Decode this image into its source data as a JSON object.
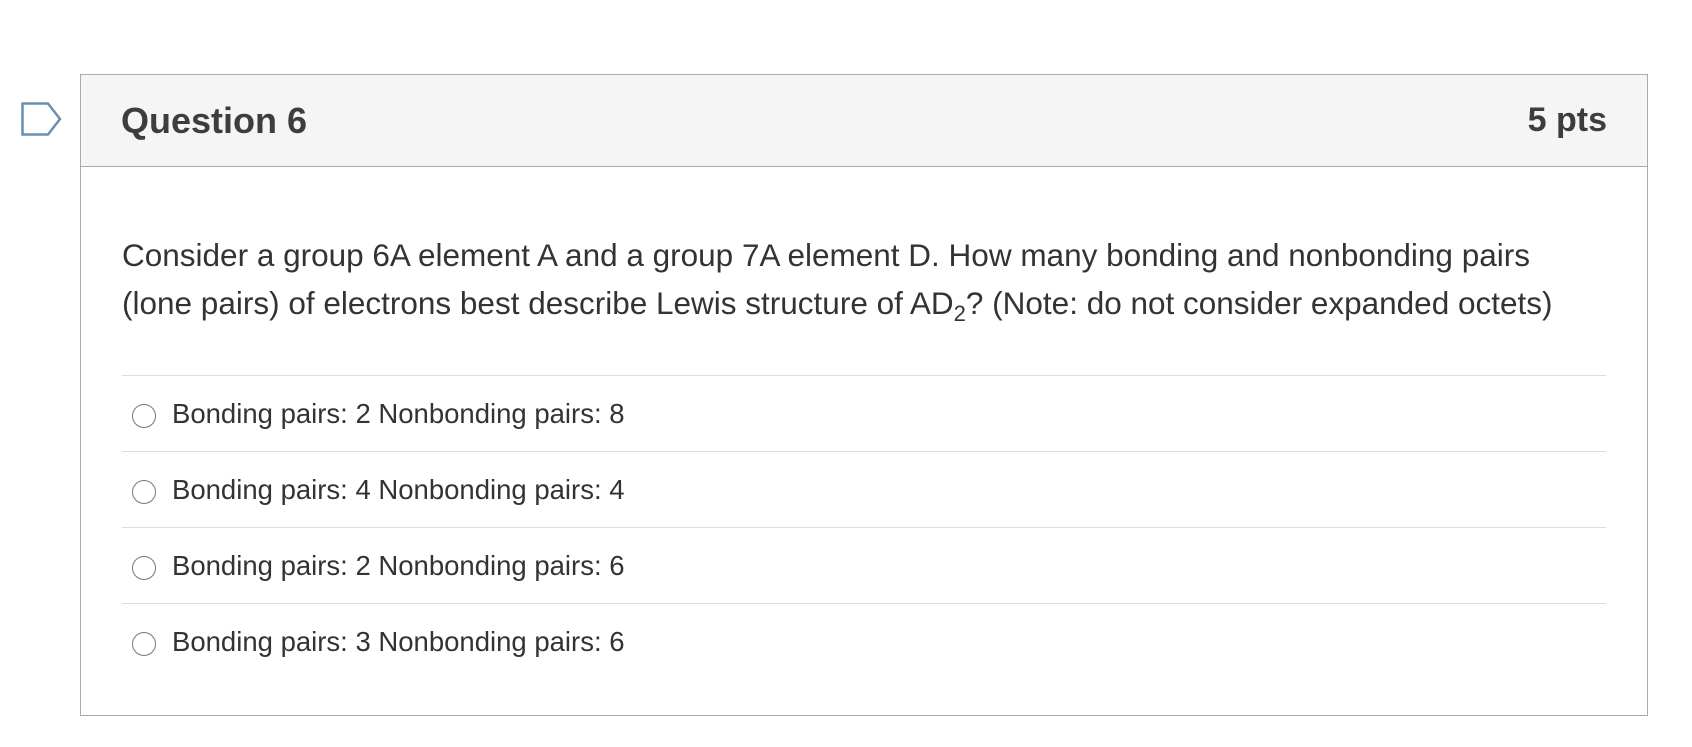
{
  "flag": {
    "icon": "flag-outline-icon",
    "color": "#6b8fb0"
  },
  "question": {
    "title": "Question 6",
    "points": "5 pts",
    "text_part1": "Consider a group 6A element A and a group 7A element D. How many bonding and nonbonding pairs (lone pairs) of electrons best describe Lewis structure of AD",
    "text_subscript": "2",
    "text_part2": "? (Note: do not consider expanded octets)",
    "answers": [
      {
        "label": "Bonding pairs: 2 Nonbonding pairs: 8",
        "selected": false
      },
      {
        "label": "Bonding pairs: 4 Nonbonding pairs: 4",
        "selected": false
      },
      {
        "label": "Bonding pairs: 2 Nonbonding pairs: 6",
        "selected": false
      },
      {
        "label": "Bonding pairs: 3 Nonbonding pairs: 6",
        "selected": false
      }
    ]
  }
}
